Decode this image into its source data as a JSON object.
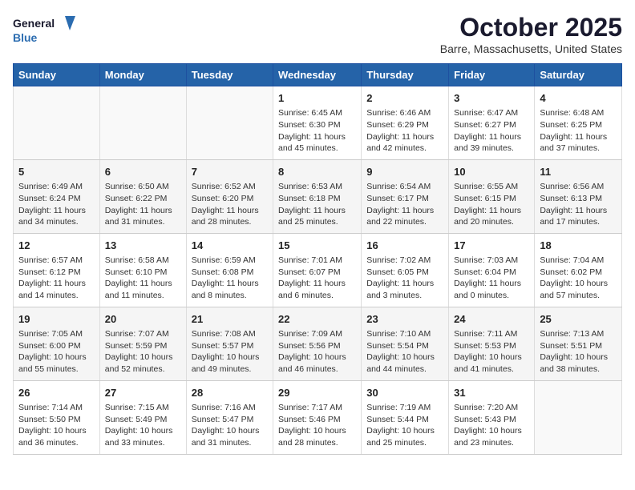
{
  "header": {
    "logo_line1": "General",
    "logo_line2": "Blue",
    "title": "October 2025",
    "subtitle": "Barre, Massachusetts, United States"
  },
  "columns": [
    "Sunday",
    "Monday",
    "Tuesday",
    "Wednesday",
    "Thursday",
    "Friday",
    "Saturday"
  ],
  "weeks": [
    [
      {
        "day": "",
        "info": ""
      },
      {
        "day": "",
        "info": ""
      },
      {
        "day": "",
        "info": ""
      },
      {
        "day": "1",
        "info": "Sunrise: 6:45 AM\nSunset: 6:30 PM\nDaylight: 11 hours and 45 minutes."
      },
      {
        "day": "2",
        "info": "Sunrise: 6:46 AM\nSunset: 6:29 PM\nDaylight: 11 hours and 42 minutes."
      },
      {
        "day": "3",
        "info": "Sunrise: 6:47 AM\nSunset: 6:27 PM\nDaylight: 11 hours and 39 minutes."
      },
      {
        "day": "4",
        "info": "Sunrise: 6:48 AM\nSunset: 6:25 PM\nDaylight: 11 hours and 37 minutes."
      }
    ],
    [
      {
        "day": "5",
        "info": "Sunrise: 6:49 AM\nSunset: 6:24 PM\nDaylight: 11 hours and 34 minutes."
      },
      {
        "day": "6",
        "info": "Sunrise: 6:50 AM\nSunset: 6:22 PM\nDaylight: 11 hours and 31 minutes."
      },
      {
        "day": "7",
        "info": "Sunrise: 6:52 AM\nSunset: 6:20 PM\nDaylight: 11 hours and 28 minutes."
      },
      {
        "day": "8",
        "info": "Sunrise: 6:53 AM\nSunset: 6:18 PM\nDaylight: 11 hours and 25 minutes."
      },
      {
        "day": "9",
        "info": "Sunrise: 6:54 AM\nSunset: 6:17 PM\nDaylight: 11 hours and 22 minutes."
      },
      {
        "day": "10",
        "info": "Sunrise: 6:55 AM\nSunset: 6:15 PM\nDaylight: 11 hours and 20 minutes."
      },
      {
        "day": "11",
        "info": "Sunrise: 6:56 AM\nSunset: 6:13 PM\nDaylight: 11 hours and 17 minutes."
      }
    ],
    [
      {
        "day": "12",
        "info": "Sunrise: 6:57 AM\nSunset: 6:12 PM\nDaylight: 11 hours and 14 minutes."
      },
      {
        "day": "13",
        "info": "Sunrise: 6:58 AM\nSunset: 6:10 PM\nDaylight: 11 hours and 11 minutes."
      },
      {
        "day": "14",
        "info": "Sunrise: 6:59 AM\nSunset: 6:08 PM\nDaylight: 11 hours and 8 minutes."
      },
      {
        "day": "15",
        "info": "Sunrise: 7:01 AM\nSunset: 6:07 PM\nDaylight: 11 hours and 6 minutes."
      },
      {
        "day": "16",
        "info": "Sunrise: 7:02 AM\nSunset: 6:05 PM\nDaylight: 11 hours and 3 minutes."
      },
      {
        "day": "17",
        "info": "Sunrise: 7:03 AM\nSunset: 6:04 PM\nDaylight: 11 hours and 0 minutes."
      },
      {
        "day": "18",
        "info": "Sunrise: 7:04 AM\nSunset: 6:02 PM\nDaylight: 10 hours and 57 minutes."
      }
    ],
    [
      {
        "day": "19",
        "info": "Sunrise: 7:05 AM\nSunset: 6:00 PM\nDaylight: 10 hours and 55 minutes."
      },
      {
        "day": "20",
        "info": "Sunrise: 7:07 AM\nSunset: 5:59 PM\nDaylight: 10 hours and 52 minutes."
      },
      {
        "day": "21",
        "info": "Sunrise: 7:08 AM\nSunset: 5:57 PM\nDaylight: 10 hours and 49 minutes."
      },
      {
        "day": "22",
        "info": "Sunrise: 7:09 AM\nSunset: 5:56 PM\nDaylight: 10 hours and 46 minutes."
      },
      {
        "day": "23",
        "info": "Sunrise: 7:10 AM\nSunset: 5:54 PM\nDaylight: 10 hours and 44 minutes."
      },
      {
        "day": "24",
        "info": "Sunrise: 7:11 AM\nSunset: 5:53 PM\nDaylight: 10 hours and 41 minutes."
      },
      {
        "day": "25",
        "info": "Sunrise: 7:13 AM\nSunset: 5:51 PM\nDaylight: 10 hours and 38 minutes."
      }
    ],
    [
      {
        "day": "26",
        "info": "Sunrise: 7:14 AM\nSunset: 5:50 PM\nDaylight: 10 hours and 36 minutes."
      },
      {
        "day": "27",
        "info": "Sunrise: 7:15 AM\nSunset: 5:49 PM\nDaylight: 10 hours and 33 minutes."
      },
      {
        "day": "28",
        "info": "Sunrise: 7:16 AM\nSunset: 5:47 PM\nDaylight: 10 hours and 31 minutes."
      },
      {
        "day": "29",
        "info": "Sunrise: 7:17 AM\nSunset: 5:46 PM\nDaylight: 10 hours and 28 minutes."
      },
      {
        "day": "30",
        "info": "Sunrise: 7:19 AM\nSunset: 5:44 PM\nDaylight: 10 hours and 25 minutes."
      },
      {
        "day": "31",
        "info": "Sunrise: 7:20 AM\nSunset: 5:43 PM\nDaylight: 10 hours and 23 minutes."
      },
      {
        "day": "",
        "info": ""
      }
    ]
  ]
}
